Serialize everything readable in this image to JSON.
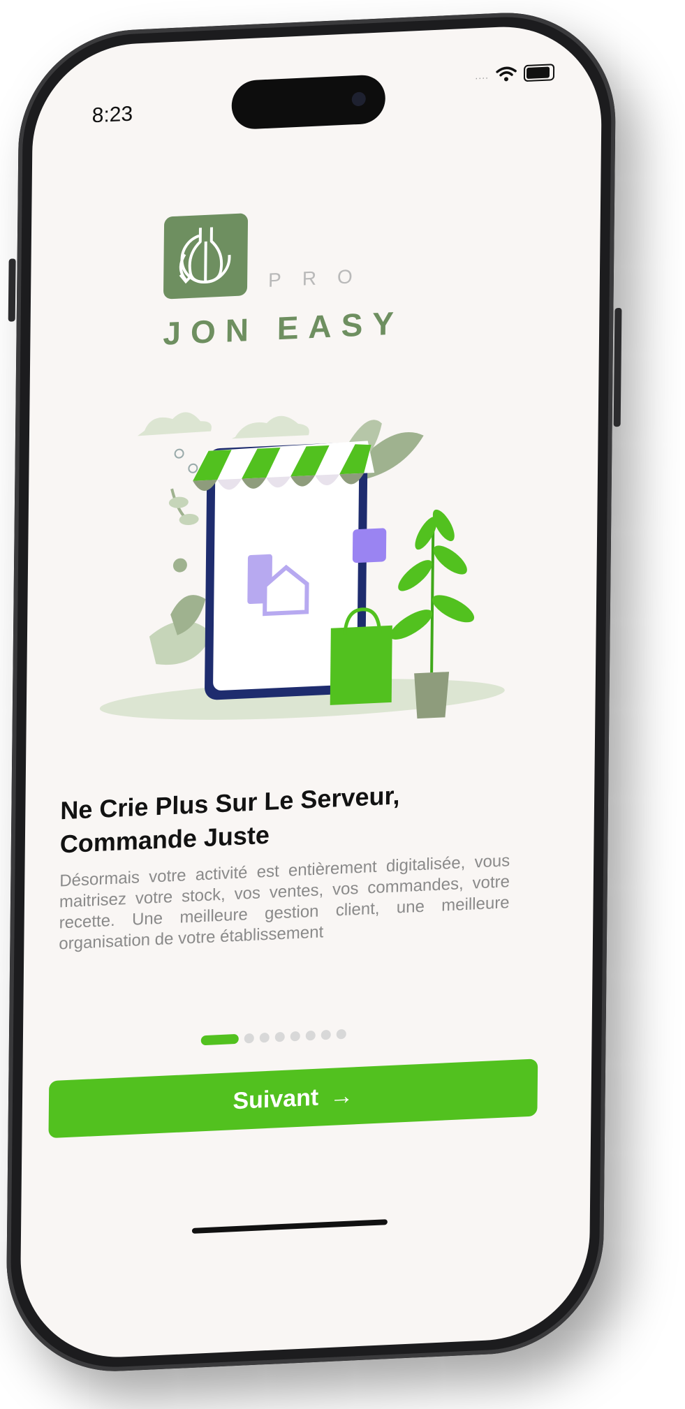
{
  "status_bar": {
    "time": "8:23",
    "signal_text": "....",
    "wifi_icon": "wifi-icon",
    "battery_icon": "battery-icon"
  },
  "brand": {
    "tagline": "PRO",
    "name": "JON EASY",
    "logo_icon": "bottle-refresh-icon",
    "logo_color": "#6e8f60"
  },
  "illustration": {
    "icon": "storefront-phone-illustration"
  },
  "onboarding": {
    "title": "Ne Crie Plus Sur Le Serveur, Commande Juste",
    "description": "Désormais votre activité est entièrement digitalisée, vous maitrisez votre stock, vos ventes, vos commandes, votre recette. Une meilleure gestion client, une meilleure organisation de votre établissement",
    "page_index": 1,
    "page_count": 8
  },
  "cta": {
    "label": "Suivant",
    "arrow": "→",
    "color": "#52c11f"
  }
}
